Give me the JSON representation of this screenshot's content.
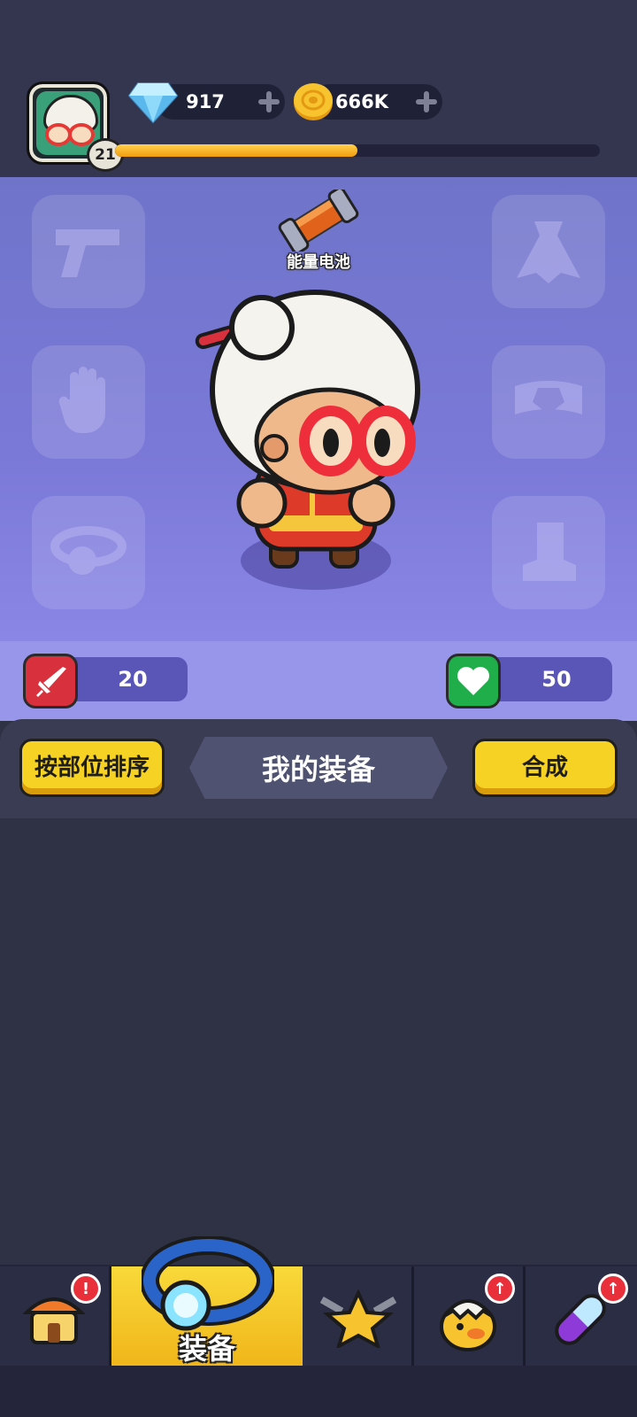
{
  "player": {
    "level": "21",
    "xp_progress": 0.5
  },
  "currencies": {
    "gems": "917",
    "gold": "666K"
  },
  "equipment_stage": {
    "featured_item_label": "能量电池",
    "slots": [
      "gun-icon",
      "cape-icon",
      "glove-icon",
      "belt-icon",
      "ring-icon",
      "boot-icon"
    ]
  },
  "stats": {
    "attack": "20",
    "health": "50"
  },
  "toolbar": {
    "sort_label": "按部位排序",
    "title": "我的装备",
    "merge_label": "合成"
  },
  "nav": {
    "active_label": "装备",
    "shop_badge": "!",
    "pet_badge": "↑",
    "item_badge": "↑"
  },
  "colors": {
    "accent_yellow": "#f5d223",
    "stage_purple": "#7b79d8",
    "attack_red": "#d8303c",
    "health_green": "#1fae4a"
  }
}
